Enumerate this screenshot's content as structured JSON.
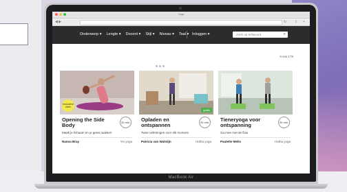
{
  "browser": {
    "window_title": "Yoga"
  },
  "laptop": {
    "brand": "MacBook Air"
  },
  "nav": {
    "items": [
      "Onderwerp ▾",
      "Lengte ▾",
      "Docent ▾",
      "Stijl ▾",
      "Niveau ▾",
      "Taal ▾"
    ],
    "login": "Inloggen ▾",
    "search_placeholder": "Zoek op trefwoord"
  },
  "results": "9 van 178",
  "cards": [
    {
      "title": "Opening the Side Body",
      "subtitle": "Maak je lichaam én je geest wakker!",
      "author": "Nanna Bray",
      "category": "Yin yoga",
      "duration": "20 min.",
      "badge": "exclusieve video"
    },
    {
      "title": "Opladen en ontspannen",
      "subtitle": "Twee oefeningen voor elk moment",
      "author": "Patricia van Walstijn",
      "category": "Hatha yoga",
      "duration": "20 min.",
      "tag": "gratis"
    },
    {
      "title": "Tieneryoga voor ontspanning",
      "subtitle": "Ga mee met de flow",
      "author": "Paulette Melis",
      "category": "Hatha yoga",
      "duration": "20 min."
    }
  ],
  "colors": {
    "navbar": "#2c2c2e",
    "badge": "#f3e94a",
    "tag": "#4caf50"
  }
}
